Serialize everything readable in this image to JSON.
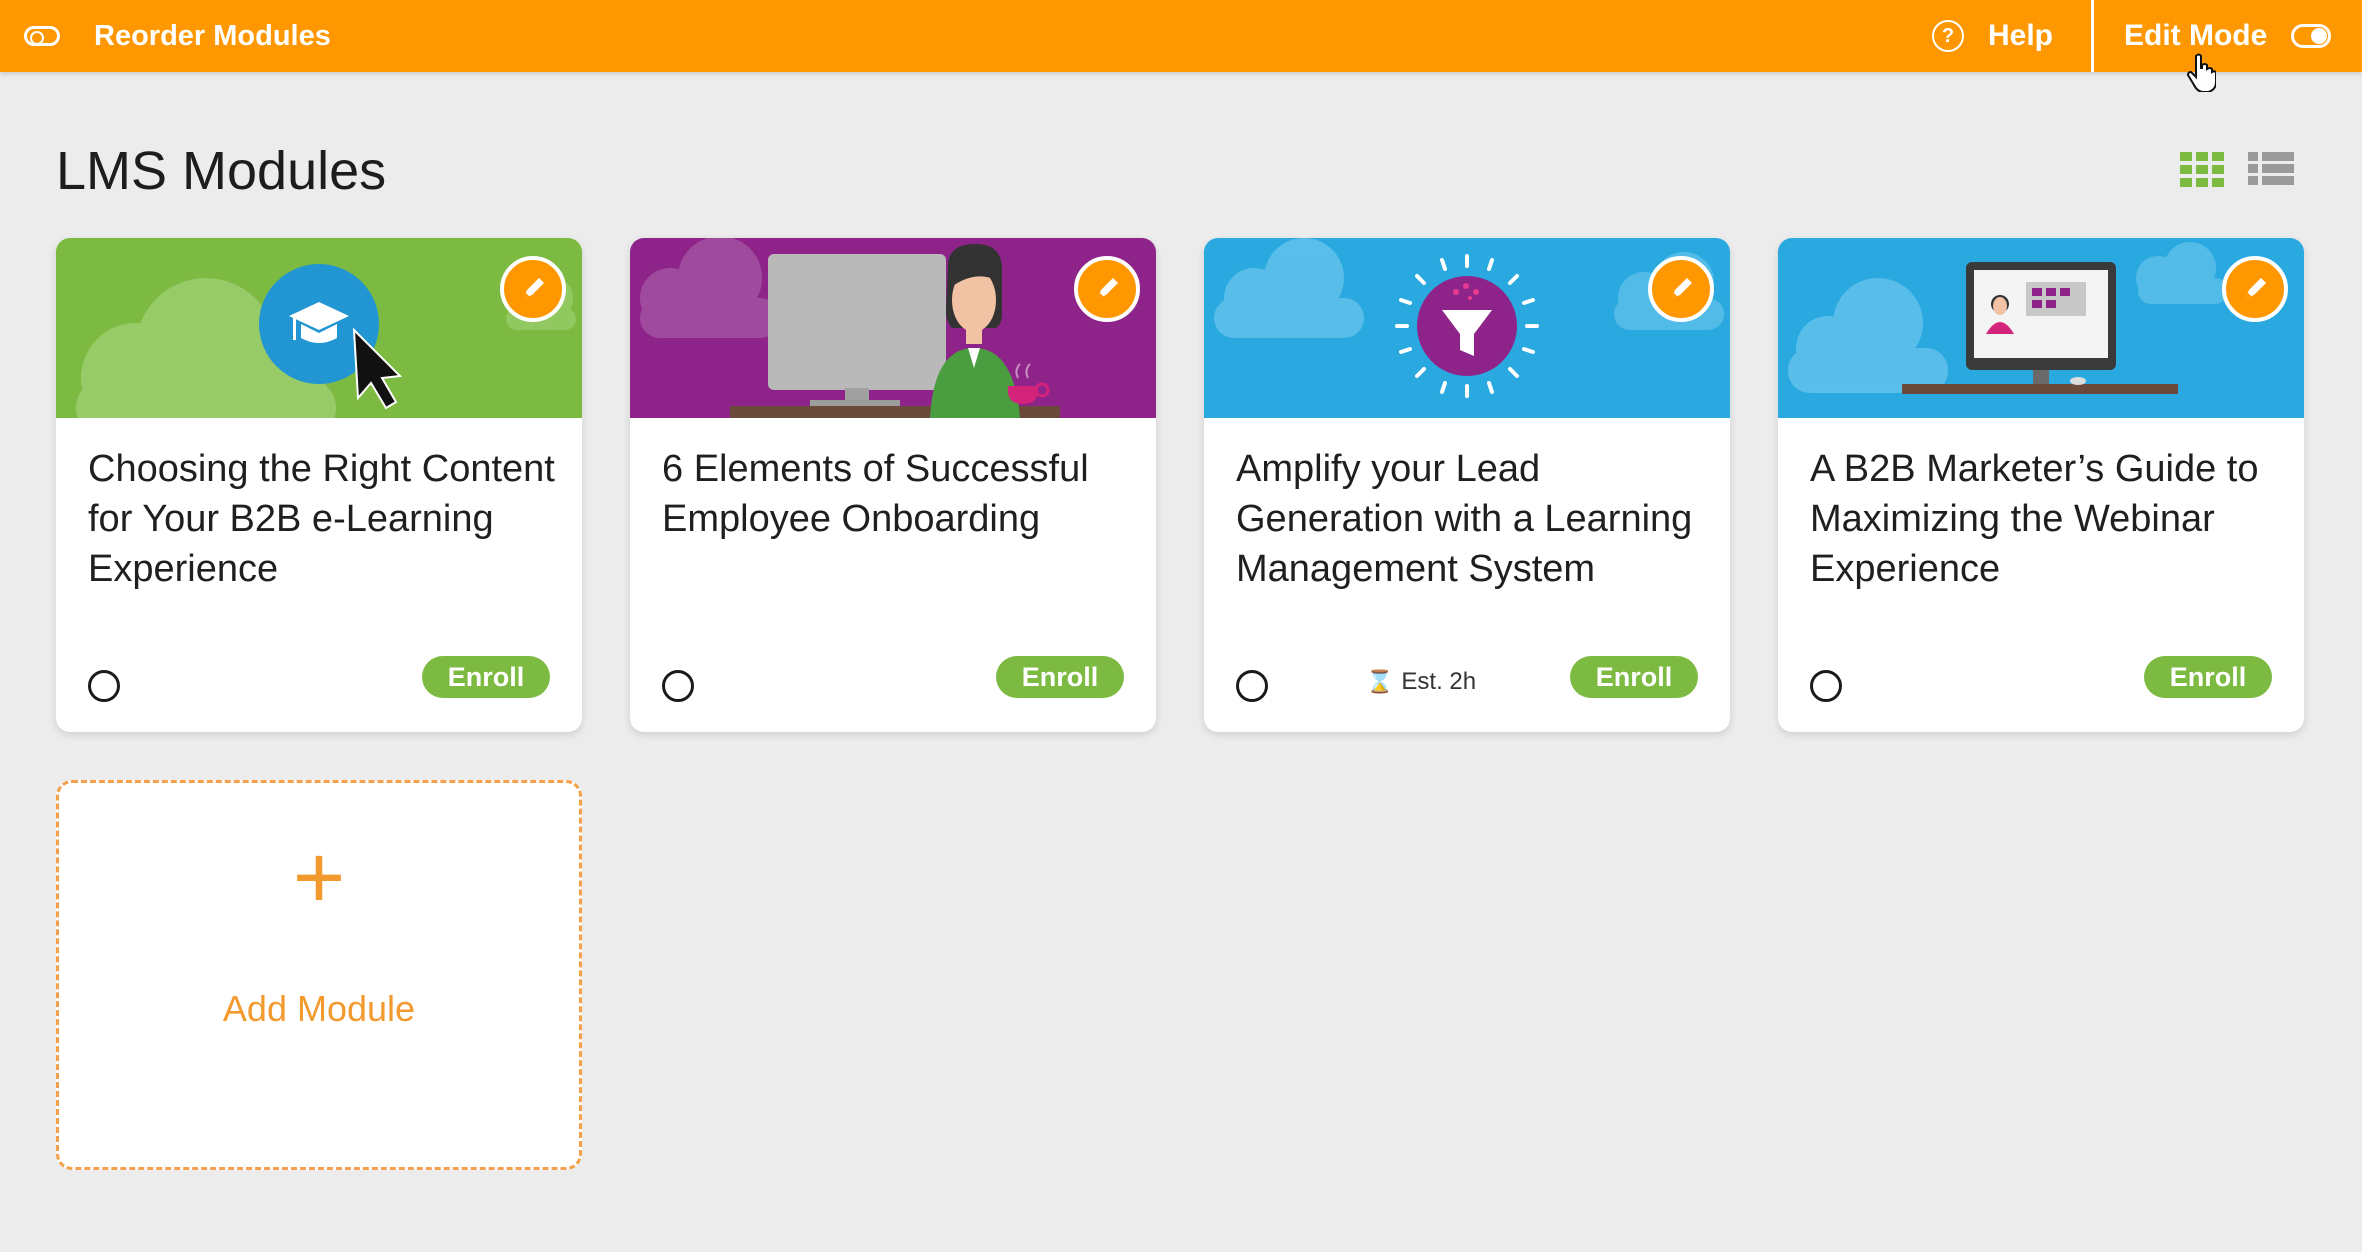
{
  "topbar": {
    "reorder_label": "Reorder Modules",
    "help_label": "Help",
    "edit_mode_label": "Edit Mode",
    "edit_mode_on": true,
    "color": "#ff9700"
  },
  "header": {
    "title": "LMS Modules",
    "view_modes": [
      "grid",
      "list"
    ],
    "active_view": "grid"
  },
  "modules": [
    {
      "title": "Choosing the Right Content for Your B2B e-Learning Experience",
      "enroll_label": "Enroll",
      "estimate": "",
      "banner_color": "#7dba41",
      "banner_icon": "graduation-cap-icon"
    },
    {
      "title": "6 Elements of Successful Employee Onboarding",
      "enroll_label": "Enroll",
      "estimate": "",
      "banner_color": "#8e2489",
      "banner_icon": "employee-desk-illustration"
    },
    {
      "title": "Amplify your Lead Generation with a Learning Management System",
      "enroll_label": "Enroll",
      "estimate": "Est. 2h",
      "banner_color": "#2aa9e0",
      "banner_icon": "funnel-icon"
    },
    {
      "title": "A B2B Marketer’s Guide to Maximizing the Webinar Experience",
      "enroll_label": "Enroll",
      "estimate": "",
      "banner_color": "#2aa9e0",
      "banner_icon": "webinar-monitor-illustration"
    }
  ],
  "add_module": {
    "plus": "+",
    "label": "Add Module"
  },
  "colors": {
    "accent": "#ff9700",
    "enroll": "#7dba41",
    "background": "#ececec"
  }
}
